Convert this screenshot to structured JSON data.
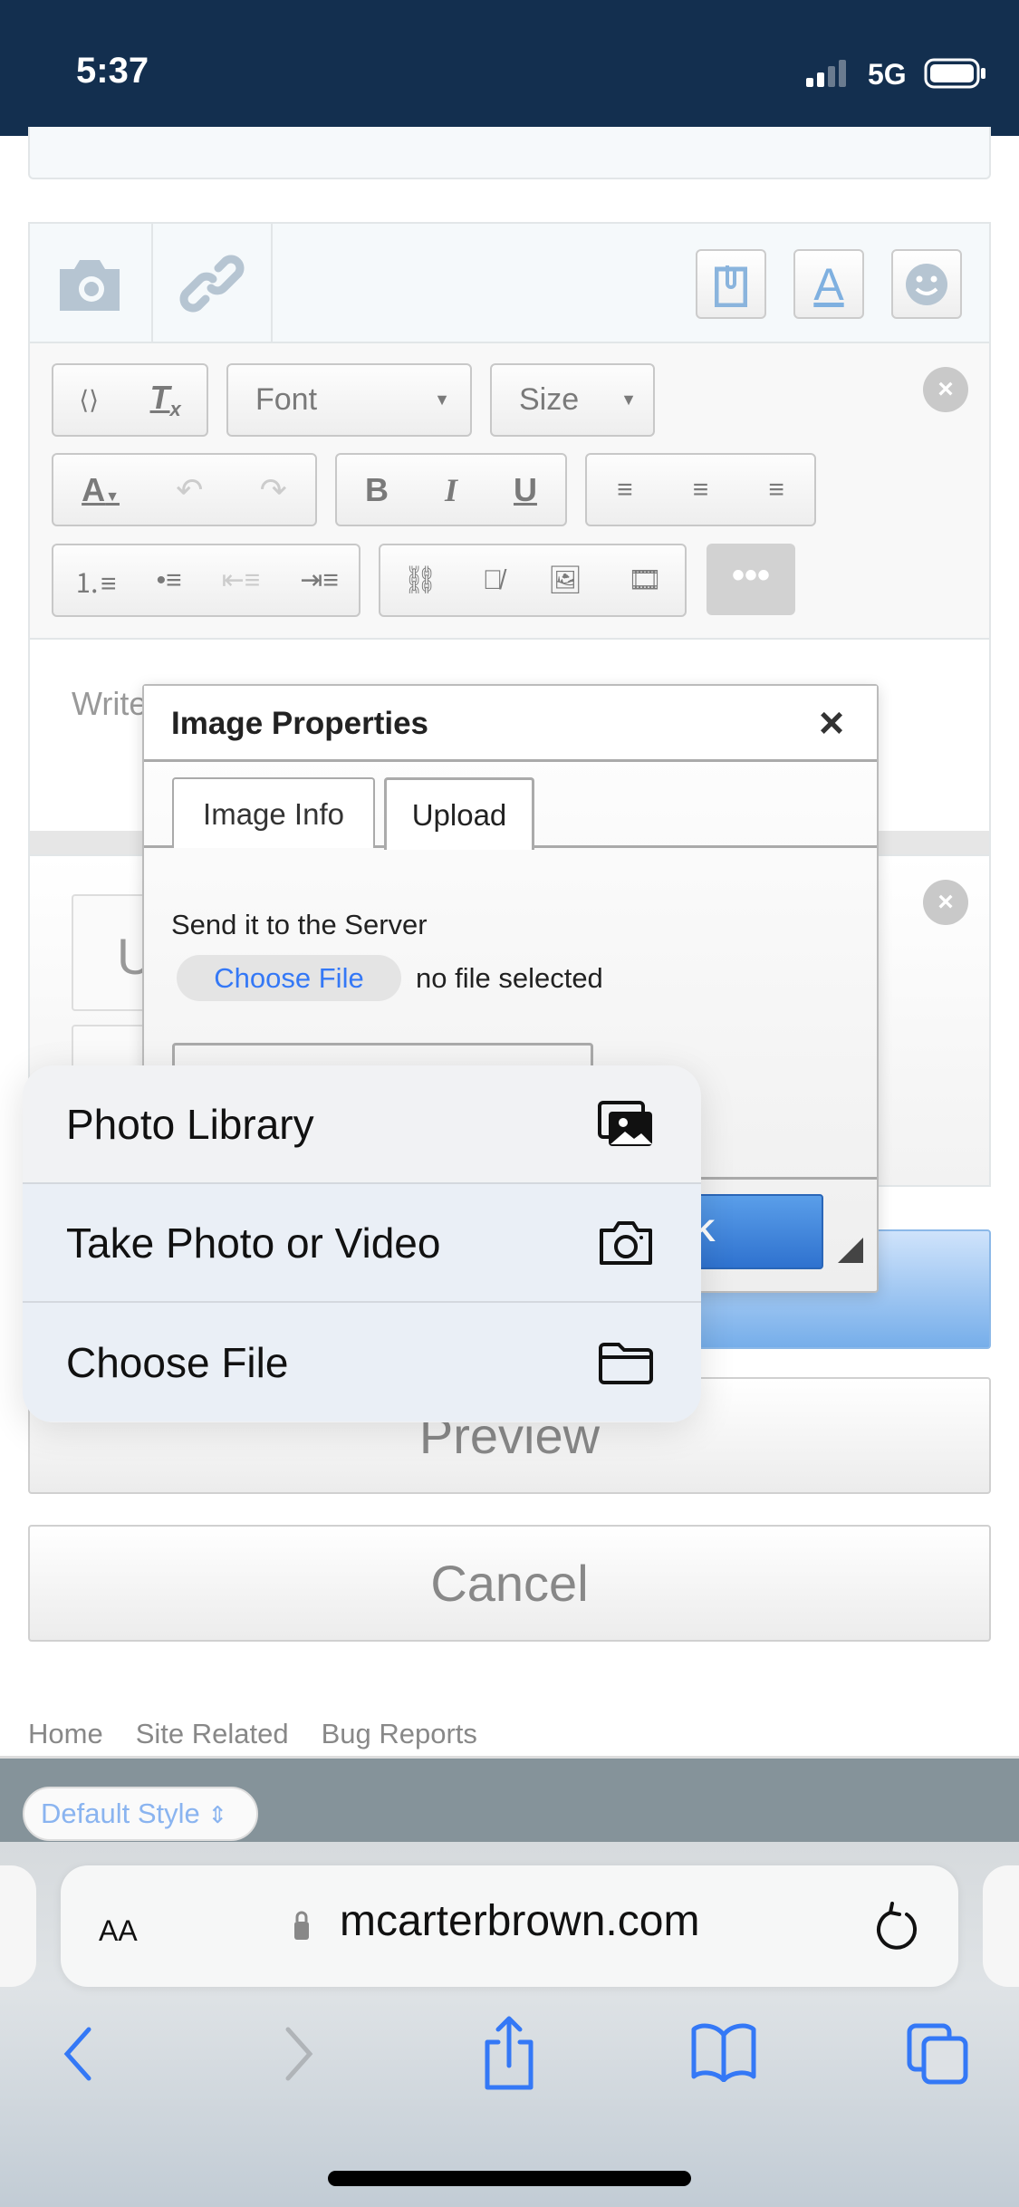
{
  "status_bar": {
    "time": "5:37",
    "network": "5G",
    "battery_level": 1.0
  },
  "editor": {
    "font_dropdown": "Font",
    "size_dropdown": "Size",
    "placeholder": "Write",
    "partial_button_text": "U"
  },
  "dialog": {
    "title": "Image Properties",
    "tabs": [
      "Image Info",
      "Upload"
    ],
    "active_tab": "Upload",
    "section_label": "Send it to the Server",
    "choose_file": "Choose File",
    "file_status": "no file selected",
    "ok": "OK"
  },
  "action_sheet": {
    "items": [
      {
        "label": "Photo Library",
        "icon": "photo-library-icon"
      },
      {
        "label": "Take Photo or Video",
        "icon": "camera-icon"
      },
      {
        "label": "Choose File",
        "icon": "folder-icon"
      }
    ]
  },
  "page_buttons": {
    "preview": "Preview",
    "cancel": "Cancel"
  },
  "footer": {
    "links": [
      "Home",
      "Site Related",
      "Bug Reports"
    ],
    "style_select": "Default Style"
  },
  "browser": {
    "aa": "AA",
    "url": "mcarterbrown.com"
  },
  "colors": {
    "status_bar": "#132f4f",
    "accent": "#3478f6",
    "ok_button": "#3a84dc"
  }
}
